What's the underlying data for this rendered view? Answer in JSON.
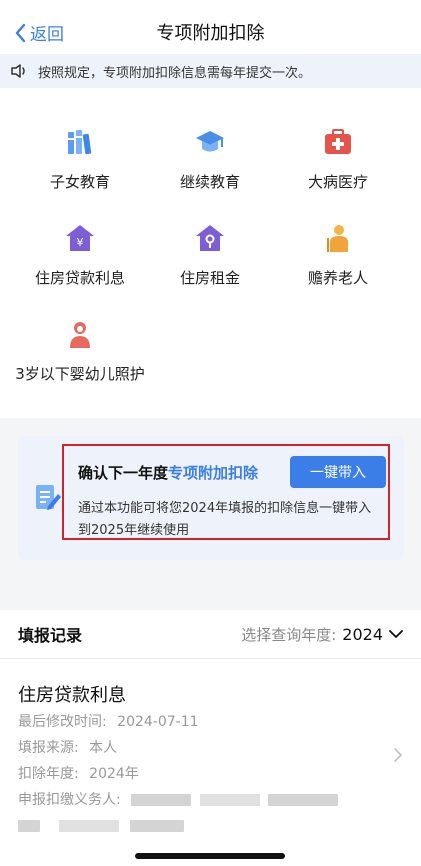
{
  "header": {
    "back_label": "返回",
    "title": "专项附加扣除"
  },
  "notice": {
    "text": "按照规定，专项附加扣除信息需每年提交一次。"
  },
  "categories": [
    {
      "label": "子女教育",
      "icon": "books-icon"
    },
    {
      "label": "继续教育",
      "icon": "graduation-cap-icon"
    },
    {
      "label": "大病医疗",
      "icon": "medical-kit-icon"
    },
    {
      "label": "住房贷款利息",
      "icon": "house-loan-icon"
    },
    {
      "label": "住房租金",
      "icon": "house-rent-icon"
    },
    {
      "label": "赡养老人",
      "icon": "elderly-icon"
    },
    {
      "label": "3岁以下婴幼儿照护",
      "icon": "infant-care-icon"
    }
  ],
  "carryover": {
    "title_plain": "确认下一年度",
    "title_highlight": "专项附加扣除",
    "button_label": "一键带入",
    "description": "通过本功能可将您2024年填报的扣除信息一键带入到2025年继续使用"
  },
  "records": {
    "heading": "填报记录",
    "year_select_label": "选择查询年度:",
    "year_value": "2024",
    "items": [
      {
        "title": "住房贷款利息",
        "modified_label": "最后修改时间:",
        "modified_value": "2024-07-11",
        "source_label": "填报来源:",
        "source_value": "本人",
        "year_label": "扣除年度:",
        "year_value": "2024年",
        "agent_label": "申报扣缴义务人:"
      }
    ]
  },
  "colors": {
    "accent": "#3b7ee8",
    "highlight_border": "#d2232a",
    "notice_bg": "#eef3fb"
  }
}
